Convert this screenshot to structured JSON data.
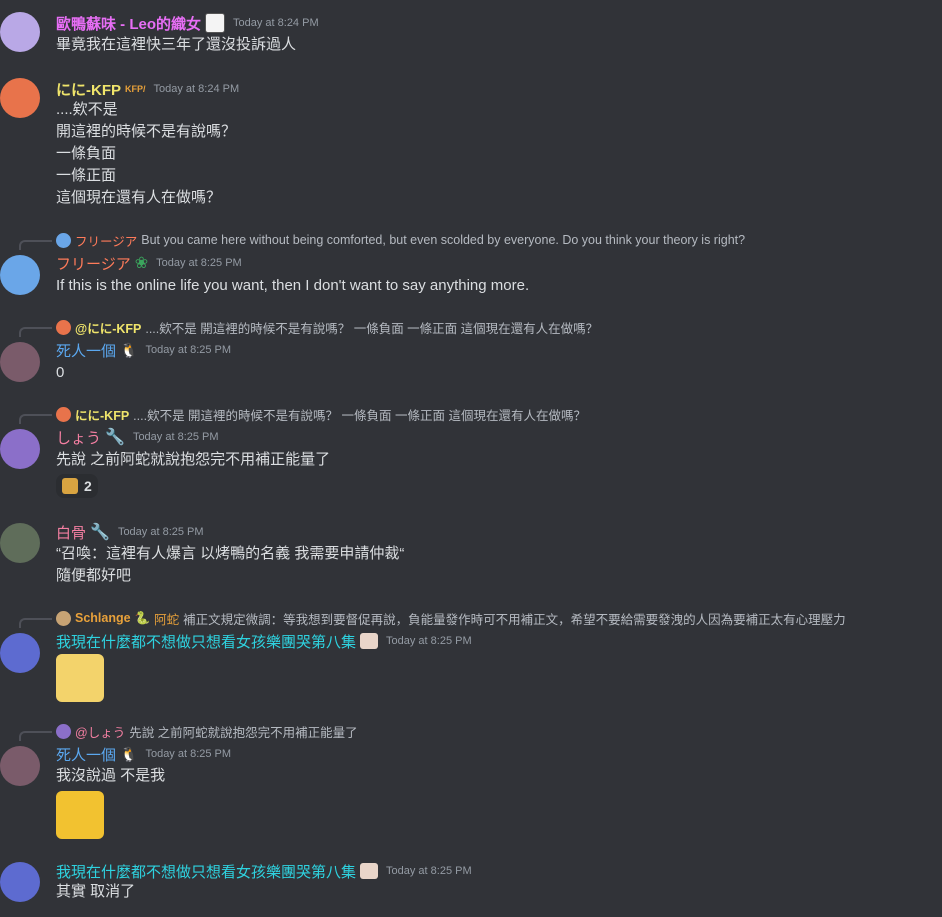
{
  "messages": [
    {
      "author": "歐鴨蘇味 - Leo的織女",
      "timestamp": "Today at 8:24 PM",
      "lines": [
        "畢竟我在這裡快三年了還沒投訴過人"
      ],
      "name_color": "#e76ef5",
      "avatar_color": "#b9a8e6"
    },
    {
      "author": "にに-KFP",
      "tag": "KFP/",
      "timestamp": "Today at 8:24 PM",
      "lines": [
        "....欸不是",
        "開這裡的時候不是有說嗎？",
        "一條負面",
        "一條正面",
        "這個現在還有人在做嗎？"
      ],
      "name_color": "#f0e56b",
      "avatar_color": "#e8734b"
    },
    {
      "reply_author": "フリージア",
      "reply_text": "But you came here without being comforted, but even scolded by everyone. Do you think your theory is right?",
      "author": "フリージア",
      "timestamp": "Today at 8:25 PM",
      "lines": [
        "If this is the online life you want, then I don't want to say anything more."
      ],
      "name_color": "#ff7b5a",
      "avatar_color": "#6aa6e8"
    },
    {
      "reply_author": "@にに-KFP",
      "reply_text": "....欸不是 開這裡的時候不是有說嗎？ 一條負面 一條正面 這個現在還有人在做嗎？",
      "author": "死人一個",
      "timestamp": "Today at 8:25 PM",
      "lines": [
        "0"
      ],
      "name_color": "#5ba8f0",
      "avatar_color": "#7a5b6a"
    },
    {
      "reply_author": "にに-KFP",
      "reply_text": "....欸不是 開這裡的時候不是有說嗎？ 一條負面 一條正面 這個現在還有人在做嗎？",
      "author": "しょう",
      "timestamp": "Today at 8:25 PM",
      "lines": [
        "先說 之前阿蛇就說抱怨完不用補正能量了"
      ],
      "reaction_count": "2",
      "name_color": "#f47fa2",
      "avatar_color": "#8b6fc9"
    },
    {
      "author": "白骨",
      "timestamp": "Today at 8:25 PM",
      "lines": [
        "“召喚：這裡有人爆言 以烤鴨的名義 我需要申請仲裁“",
        "隨便都好吧"
      ],
      "name_color": "#f47fa2",
      "avatar_color": "#5f6d5a"
    },
    {
      "reply_author": "Schlange",
      "reply_author2": "阿蛇",
      "reply_text": "補正文規定微調：等我想到要督促再說，負能量發作時可不用補正文，希望不要給需要發洩的人因為要補正太有心理壓力",
      "author": "我現在什麼都不想做只想看女孩樂團哭第八集",
      "timestamp": "Today at 8:25 PM",
      "lines": [],
      "name_color": "#2ed3e0",
      "avatar_color": "#5d6bd0"
    },
    {
      "reply_author": "@しょう",
      "reply_text": "先說 之前阿蛇就說抱怨完不用補正能量了",
      "author": "死人一個",
      "timestamp": "Today at 8:25 PM",
      "lines": [
        "我沒說過 不是我"
      ],
      "name_color": "#5ba8f0",
      "avatar_color": "#7a5b6a"
    },
    {
      "author": "我現在什麼都不想做只想看女孩樂團哭第八集",
      "timestamp": "Today at 8:25 PM",
      "lines": [
        "其實 取消了"
      ],
      "name_color": "#2ed3e0",
      "avatar_color": "#5d6bd0"
    }
  ]
}
